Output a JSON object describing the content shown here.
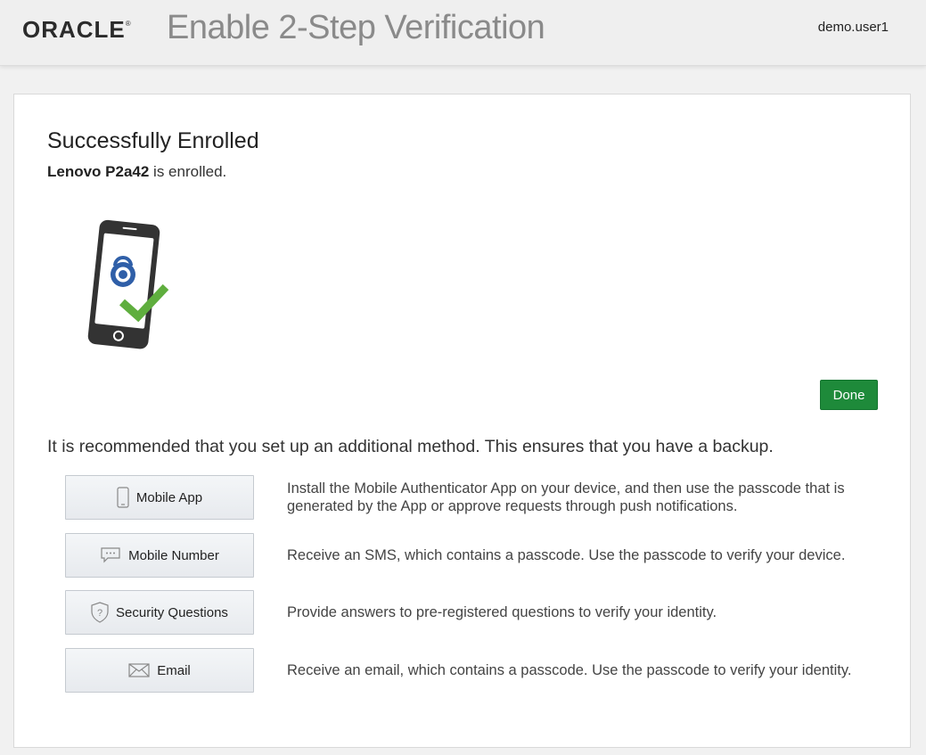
{
  "header": {
    "logo_text": "ORACLE",
    "logo_mark": "®",
    "title": "Enable 2-Step Verification",
    "username": "demo.user1"
  },
  "main": {
    "heading": "Successfully Enrolled",
    "device_name": "Lenovo P2a42",
    "enrolled_suffix": " is enrolled.",
    "illustration": "phone-lock-check-icon",
    "done_label": "Done",
    "recommendation": "It is recommended that you set up an additional method. This ensures that you have a backup."
  },
  "methods": [
    {
      "label": "Mobile App",
      "icon": "mobile-phone-icon",
      "description": "Install the Mobile Authenticator App on your device, and then use the passcode that is generated by the App or approve requests through push notifications."
    },
    {
      "label": "Mobile Number",
      "icon": "sms-bubble-icon",
      "description": "Receive an SMS, which contains a passcode. Use the passcode to verify your device."
    },
    {
      "label": "Security Questions",
      "icon": "shield-question-icon",
      "description": "Provide answers to pre-registered questions to verify your identity."
    },
    {
      "label": "Email",
      "icon": "envelope-icon",
      "description": "Receive an email, which contains a passcode. Use the passcode to verify your identity."
    }
  ],
  "colors": {
    "done_button": "#1e8a3a",
    "lock_blue": "#2f5fa8",
    "check_green": "#5fae3e",
    "phone_body": "#333333"
  }
}
